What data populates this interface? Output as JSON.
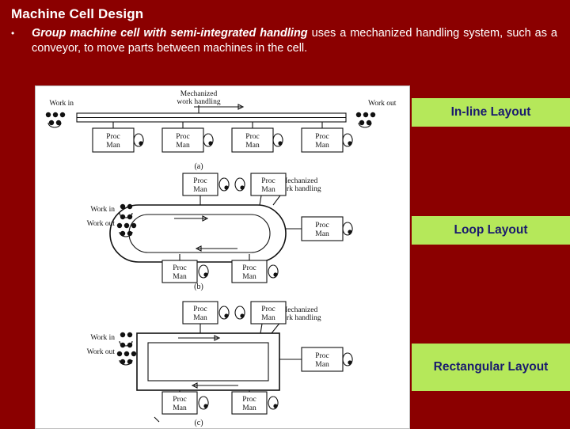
{
  "slide": {
    "title": "Machine Cell Design",
    "bullet_marker": "•",
    "bullet_lead": "Group machine cell with semi-integrated handling",
    "bullet_rest": " uses a mechanized handling system, such as a conveyor, to move parts between machines in the cell.",
    "background_color": "#8b0000",
    "title_color": "#ffffff",
    "callout_bg": "#b5e85a",
    "callout_text_color": "#1a1a6e"
  },
  "callouts": [
    {
      "label": "In-line Layout"
    },
    {
      "label": "Loop Layout"
    },
    {
      "label": "Rectangular Layout"
    }
  ],
  "figure": {
    "caption_a": "(a)",
    "caption_b": "(b)",
    "caption_c": "(c)",
    "labels": {
      "mech_handling": "Mechanized\nwork handling",
      "mech_handling_b": "Mechanized\nwork handling",
      "mech_handling_c": "Mechanized\nwork handling",
      "work_in": "Work in",
      "work_out": "Work out",
      "proc_man": "Proc\nMan",
      "proc": "Proc",
      "man": "Man"
    },
    "diagram_a": {
      "caption": "(a)",
      "top_label": "Mechanized\nwork handling",
      "work_in": "Work in",
      "work_out": "Work out",
      "stations": [
        "Proc Man",
        "Proc Man",
        "Proc Man",
        "Proc Man"
      ]
    },
    "diagram_b": {
      "caption": "(b)",
      "top_label": "Mechanized\nwork handling",
      "work_in": "Work in",
      "work_out": "Work out",
      "stations": [
        "Proc Man",
        "Proc Man",
        "Proc Man",
        "Proc Man",
        "Proc Man"
      ]
    },
    "diagram_c": {
      "caption": "(c)",
      "top_label": "Mechanized\nwork handling",
      "work_in": "Work in",
      "work_out": "Work out",
      "stations": [
        "Proc Man",
        "Proc Man",
        "Proc Man",
        "Proc Man",
        "Proc Man"
      ]
    }
  }
}
